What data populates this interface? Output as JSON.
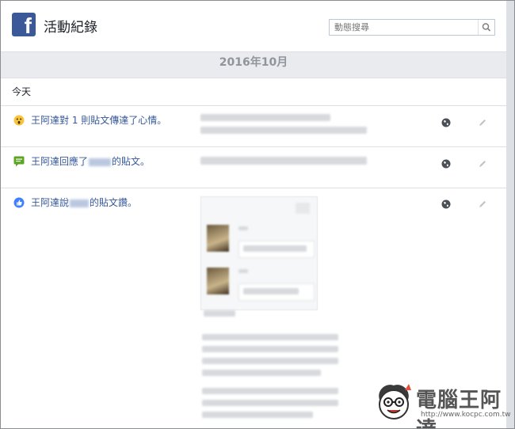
{
  "header": {
    "logo_letter": "f",
    "title": "活動紀錄",
    "search_placeholder": "動態搜尋"
  },
  "timeline": {
    "month_label": "2016年10月",
    "day_label": "今天"
  },
  "activities": [
    {
      "icon": "wow-reaction-icon",
      "actor": "王阿達",
      "text": "王阿達對 1 則貼文傳達了心情。"
    },
    {
      "icon": "comment-icon",
      "actor": "王阿達",
      "text_before": "王阿達回應了",
      "text_after": "的貼文。"
    },
    {
      "icon": "like-icon",
      "actor": "王阿達",
      "text_before": "王阿達說",
      "text_after": "的貼文讚。"
    }
  ],
  "watermark": {
    "site_name": "電腦王阿達",
    "url": "http://www.kocpc.com.tw"
  },
  "colors": {
    "facebook_blue": "#3b5998",
    "link_blue": "#365899",
    "background": "#e9ebee"
  }
}
